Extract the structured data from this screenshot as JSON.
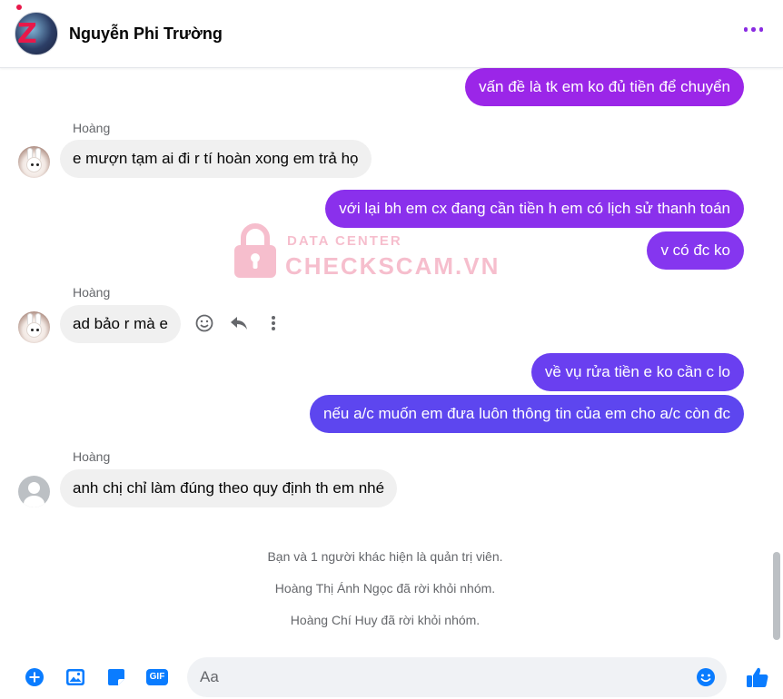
{
  "header": {
    "name": "Nguyễn Phi Trường"
  },
  "messages": [
    {
      "side": "out",
      "text": "vấn đề là tk em ko đủ tiền để chuyển",
      "color": "#9b26e8"
    },
    {
      "side": "in",
      "sender": "Hoàng",
      "text": "e mượn tạm ai đi r tí hoàn xong em trả họ"
    },
    {
      "side": "out",
      "text": "với lại bh em cx đang cần tiền h em có lịch sử thanh toán",
      "color": "#8a30ec"
    },
    {
      "side": "out",
      "text": "v có đc ko",
      "color": "#8536ef"
    },
    {
      "side": "in",
      "sender": "Hoàng",
      "text": "ad bảo r mà e"
    },
    {
      "side": "out",
      "text": "về vụ rửa tiền e ko cần c lo",
      "color": "#6a3ff0"
    },
    {
      "side": "out",
      "text": "nếu a/c muốn em đưa luôn thông tin của em cho a/c còn đc",
      "color": "#5d46ef"
    },
    {
      "side": "in",
      "sender": "Hoàng",
      "text": "anh chị chỉ làm đúng theo quy định th em nhé"
    }
  ],
  "system_messages": [
    "Bạn và 1 người khác hiện là quản trị viên.",
    "Hoàng Thị Ánh Ngọc đã rời khỏi nhóm.",
    "Hoàng Chí Huy đã rời khỏi nhóm."
  ],
  "watermark": {
    "top": "DATA CENTER",
    "main": "CHECKSCAM.VN"
  },
  "composer": {
    "placeholder": "Aa",
    "gif_label": "GIF"
  },
  "colors": {
    "accent": "#0a7cff",
    "more_icon": "#8a2be2",
    "incoming_bubble": "#f0f0f0",
    "watermark": "#f08aa6"
  },
  "icons": [
    "more-options-icon",
    "emoji-reaction-icon",
    "reply-icon",
    "plus-circle-icon",
    "image-icon",
    "sticker-icon",
    "gif-icon",
    "emoji-icon",
    "like-icon"
  ]
}
